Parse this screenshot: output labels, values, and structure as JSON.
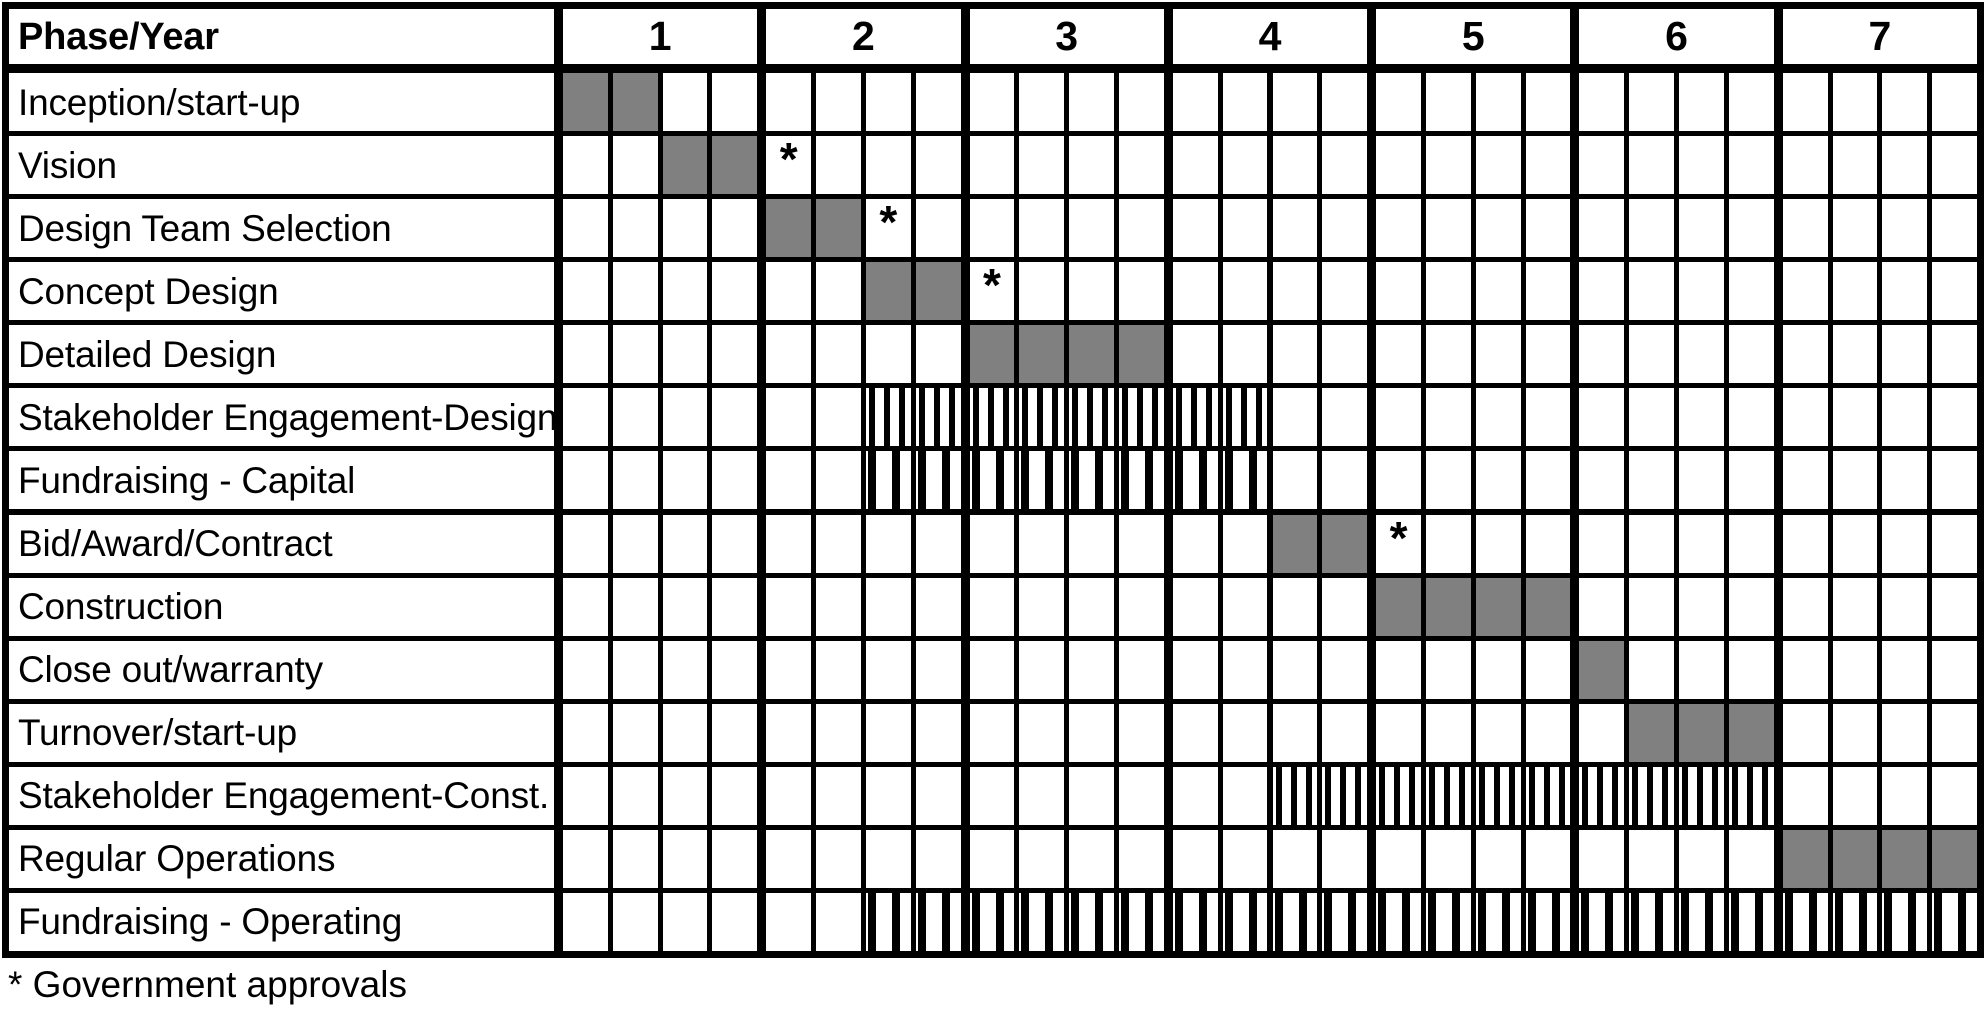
{
  "title_cell": "Phase/Year",
  "footnote": "* Government approvals",
  "legend": {
    "solid_color": "#808080",
    "dotted_pattern": "stakeholder-engagement",
    "striped_pattern": "fundraising",
    "star_symbol": "*",
    "star_meaning": "Government approvals"
  },
  "years": [
    "1",
    "2",
    "3",
    "4",
    "5",
    "6",
    "7"
  ],
  "quarters_per_year": 4,
  "total_columns": 28,
  "chart_data": {
    "type": "table",
    "title": "Phase/Year",
    "xlabel": "Year",
    "ylabel": "Phase",
    "categories": [
      "1",
      "2",
      "3",
      "4",
      "5",
      "6",
      "7"
    ],
    "columns": 28,
    "rows": [
      {
        "label": "Inception/start-up",
        "bars": [
          {
            "start": 1,
            "end": 2,
            "fill": "solid"
          }
        ],
        "stars": []
      },
      {
        "label": "Vision",
        "bars": [
          {
            "start": 3,
            "end": 4,
            "fill": "solid"
          }
        ],
        "stars": [
          5
        ]
      },
      {
        "label": "Design Team Selection",
        "bars": [
          {
            "start": 5,
            "end": 6,
            "fill": "solid"
          }
        ],
        "stars": [
          7
        ]
      },
      {
        "label": "Concept Design",
        "bars": [
          {
            "start": 7,
            "end": 8,
            "fill": "solid"
          }
        ],
        "stars": [
          9
        ]
      },
      {
        "label": "Detailed Design",
        "bars": [
          {
            "start": 9,
            "end": 12,
            "fill": "solid"
          }
        ],
        "stars": []
      },
      {
        "label": "Stakeholder Engagement-Design",
        "bars": [
          {
            "start": 7,
            "end": 14,
            "fill": "dots"
          }
        ],
        "stars": []
      },
      {
        "label": "Fundraising - Capital",
        "bars": [
          {
            "start": 7,
            "end": 14,
            "fill": "stripes"
          }
        ],
        "stars": []
      },
      {
        "label": "Bid/Award/Contract",
        "bars": [
          {
            "start": 15,
            "end": 16,
            "fill": "solid"
          }
        ],
        "stars": [
          17
        ]
      },
      {
        "label": "Construction",
        "bars": [
          {
            "start": 17,
            "end": 20,
            "fill": "solid"
          }
        ],
        "stars": []
      },
      {
        "label": "Close out/warranty",
        "bars": [
          {
            "start": 21,
            "end": 21,
            "fill": "solid"
          }
        ],
        "stars": []
      },
      {
        "label": "Turnover/start-up",
        "bars": [
          {
            "start": 22,
            "end": 24,
            "fill": "solid"
          }
        ],
        "stars": []
      },
      {
        "label": "Stakeholder Engagement-Const.",
        "bars": [
          {
            "start": 15,
            "end": 24,
            "fill": "dots"
          }
        ],
        "stars": []
      },
      {
        "label": "Regular Operations",
        "bars": [
          {
            "start": 25,
            "end": 28,
            "fill": "solid"
          }
        ],
        "stars": []
      },
      {
        "label": "Fundraising - Operating",
        "bars": [
          {
            "start": 7,
            "end": 28,
            "fill": "stripes"
          }
        ],
        "stars": []
      }
    ]
  }
}
